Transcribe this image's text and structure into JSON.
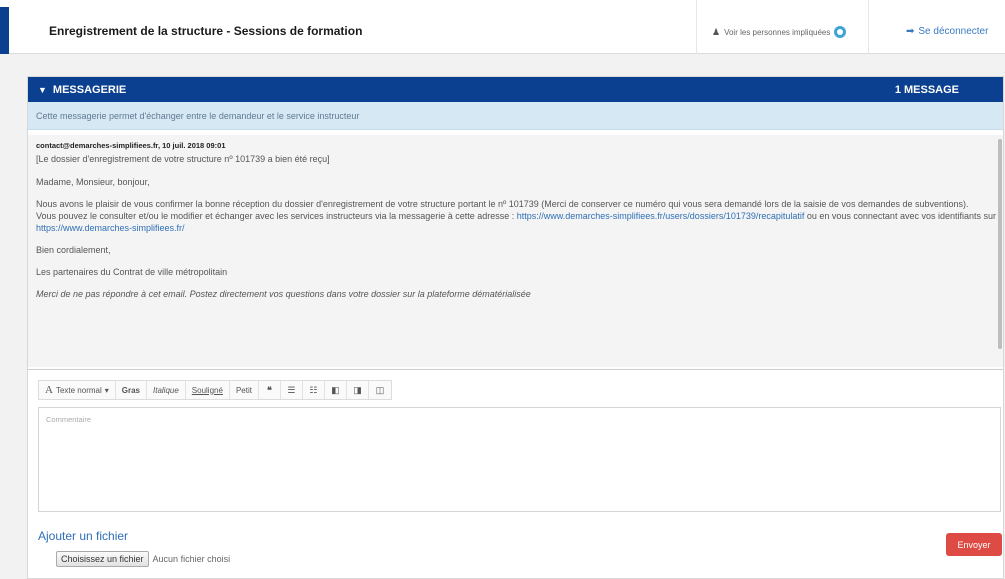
{
  "header": {
    "title": "Enregistrement de la structure - Sessions de formation",
    "people_link": "Voir les personnes impliquées",
    "logout": "Se déconnecter"
  },
  "messagerie": {
    "title": "MESSAGERIE",
    "count": "1 MESSAGE",
    "notice": "Cette messagerie permet d'échanger entre le demandeur et le service instructeur",
    "message": {
      "from": "contact@demarches-simplifiees.fr, 10 juil. 2018 09:01",
      "subject": "[Le dossier d'enregistrement de votre structure nº 101739 a bien été reçu]",
      "greeting": "Madame, Monsieur, bonjour,",
      "body1": "Nous avons le plaisir de vous confirmer la bonne réception du dossier d'enregistrement de votre structure portant le nº 101739 (Merci de conserver ce numéro qui vous sera demandé lors de la saisie de vos demandes de subventions).",
      "body2_pre": "Vous pouvez le consulter et/ou le modifier et échanger avec les services instructeurs via la messagerie à cette adresse : ",
      "body2_link": "https://www.demarches-simplifiees.fr/users/dossiers/101739/recapitulatif",
      "body2_mid": " ou en vous connectant avec vos identifiants sur ",
      "body2_link2": "https://www.demarches-simplifiees.fr/",
      "closing": "Bien cordialement,",
      "signature": "Les partenaires du Contrat de ville métropolitain",
      "footer_note": "Merci de ne pas répondre à cet email. Postez directement vos questions dans votre dossier sur la plateforme dématérialisée"
    }
  },
  "toolbar": {
    "format": "Texte normal",
    "bold": "Gras",
    "italic": "Italique",
    "underline": "Souligné",
    "small": "Petit"
  },
  "editor": {
    "placeholder": "Commentaire"
  },
  "attachment": {
    "title": "Ajouter un fichier",
    "choose_button": "Choisissez un fichier",
    "no_file": "Aucun fichier choisi"
  },
  "send_button": "Envoyer",
  "colors": {
    "brand_blue": "#0b3f8f",
    "notice_bg": "#d7e8f5",
    "link": "#2f6fb5",
    "send": "#dd4b44"
  }
}
